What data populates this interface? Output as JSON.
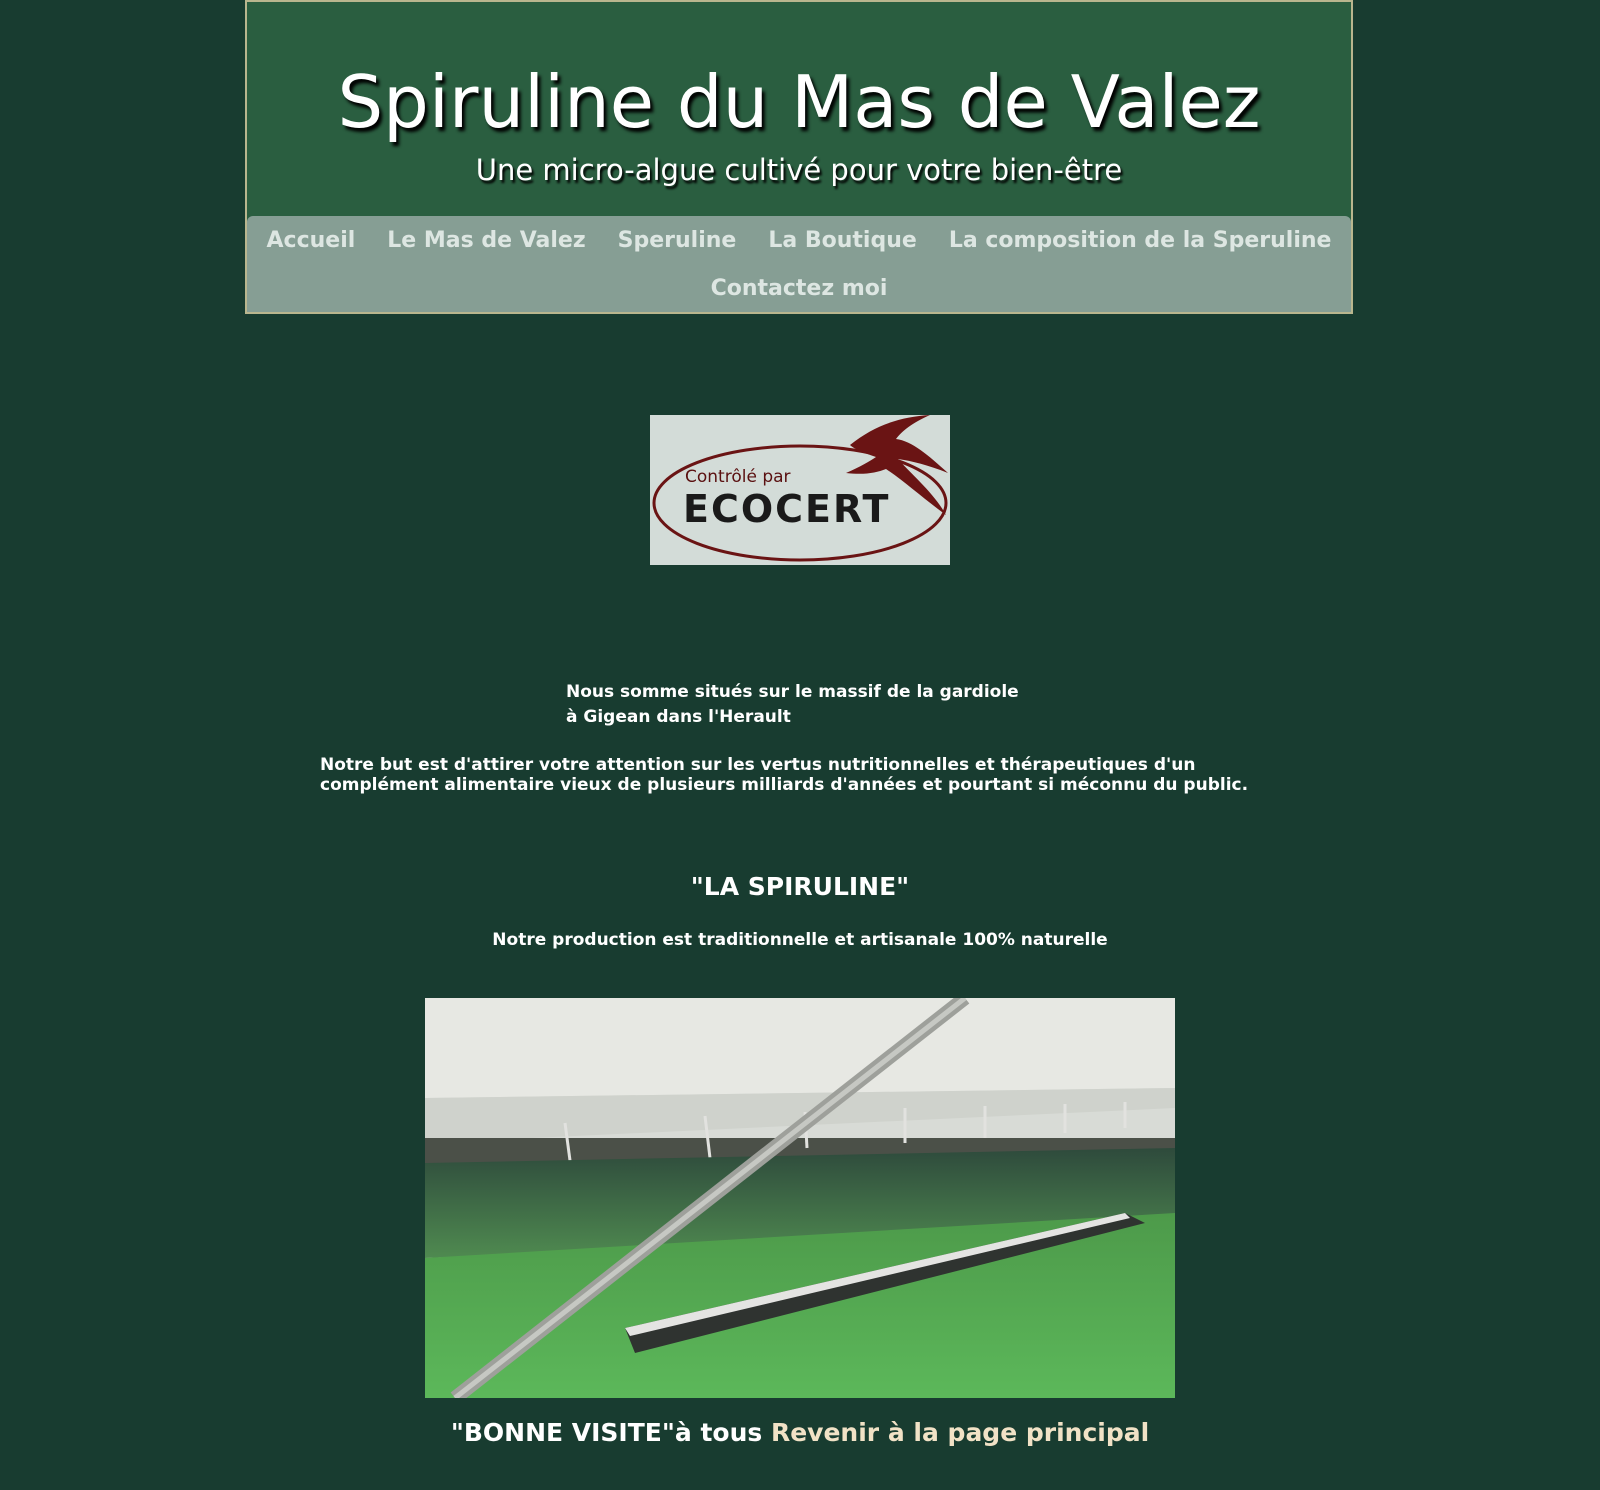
{
  "header": {
    "title": "Spiruline du Mas de Valez",
    "subtitle": "Une micro-algue cultivé pour votre bien-être"
  },
  "nav": {
    "row1": [
      "Accueil",
      "Le Mas de Valez",
      "Speruline",
      "La Boutique",
      "La composition de la Speruline"
    ],
    "row2": [
      "Contactez moi"
    ]
  },
  "logo": {
    "line1": "Contrôlé par",
    "line2": "ECOCERT",
    "icon": "swallow-bird-icon",
    "colors": {
      "ring": "#6a1414",
      "background": "#d3dcd8"
    }
  },
  "location": {
    "line1": "Nous somme situés sur le massif de la gardiole",
    "line2": "à Gigean dans l'Herault"
  },
  "intro": "Notre but est d'attirer votre attention sur les vertus nutritionnelles et thérapeutiques d'un complément alimentaire vieux de plusieurs milliards d'années et pourtant si méconnu du public.",
  "section": {
    "title": "\"LA SPIRULINE\"",
    "production": "Notre production est traditionnelle et artisanale 100% naturelle"
  },
  "photo": {
    "subject": "spirulina-basins-photo"
  },
  "footer": {
    "greeting": "\"BONNE VISITE\"à tous ",
    "link": "Revenir à la page principal"
  },
  "colors": {
    "page_bg": "#183c30",
    "header_bg": "#2a5e40",
    "nav_bg": "#869e94",
    "nav_text": "#dde6e2",
    "link": "#f1e2c6"
  }
}
